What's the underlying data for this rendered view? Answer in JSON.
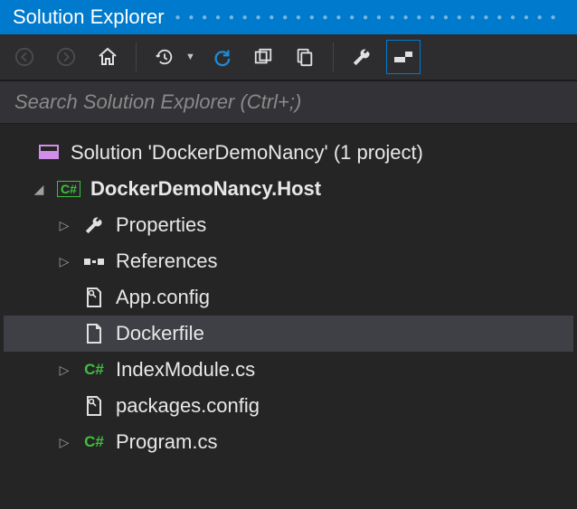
{
  "title": "Solution Explorer",
  "search": {
    "placeholder": "Search Solution Explorer (Ctrl+;)"
  },
  "toolbar": {
    "back": "back-icon",
    "forward": "forward-icon",
    "home": "home-icon",
    "history": "history-icon",
    "refresh": "refresh-icon",
    "collapse": "collapse-all-icon",
    "showall": "show-all-files-icon",
    "properties": "properties-icon",
    "preview": "preview-icon"
  },
  "tree": {
    "solution": {
      "label": "Solution 'DockerDemoNancy' (1 project)"
    },
    "project": {
      "label": "DockerDemoNancy.Host"
    },
    "items": [
      {
        "label": "Properties",
        "icon": "wrench",
        "expandable": true,
        "selected": false
      },
      {
        "label": "References",
        "icon": "refs",
        "expandable": true,
        "selected": false
      },
      {
        "label": "App.config",
        "icon": "config",
        "expandable": false,
        "selected": false
      },
      {
        "label": "Dockerfile",
        "icon": "file",
        "expandable": false,
        "selected": true
      },
      {
        "label": "IndexModule.cs",
        "icon": "csfile",
        "expandable": true,
        "selected": false
      },
      {
        "label": "packages.config",
        "icon": "config",
        "expandable": false,
        "selected": false
      },
      {
        "label": "Program.cs",
        "icon": "csfile",
        "expandable": true,
        "selected": false
      }
    ]
  }
}
